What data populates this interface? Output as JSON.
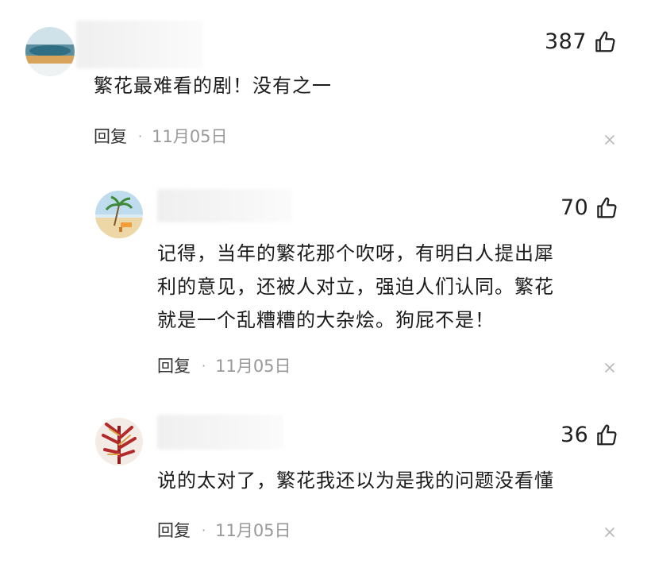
{
  "comments": [
    {
      "likes": "387",
      "text_lines": [
        "繁花最难看的剧！没有之一"
      ],
      "reply_label": "回复",
      "separator": "·",
      "date": "11月05日",
      "avatar_icon": "landscape-avatar-icon"
    },
    {
      "likes": "70",
      "text_lines": [
        "记得，当年的繁花那个吹呀，有明白人提出犀",
        "利的意见，还被人对立，强迫人们认同。繁花",
        "就是一个乱糟糟的大杂烩。狗屁不是！"
      ],
      "reply_label": "回复",
      "separator": "·",
      "date": "11月05日",
      "avatar_icon": "beach-avatar-icon"
    },
    {
      "likes": "36",
      "text_lines": [
        "说的太对了，繁花我还以为是我的问题没看懂"
      ],
      "reply_label": "回复",
      "separator": "·",
      "date": "11月05日",
      "avatar_icon": "plant-avatar-icon"
    }
  ],
  "icons": {
    "like": "thumbs-up-icon",
    "close": "close-icon"
  }
}
